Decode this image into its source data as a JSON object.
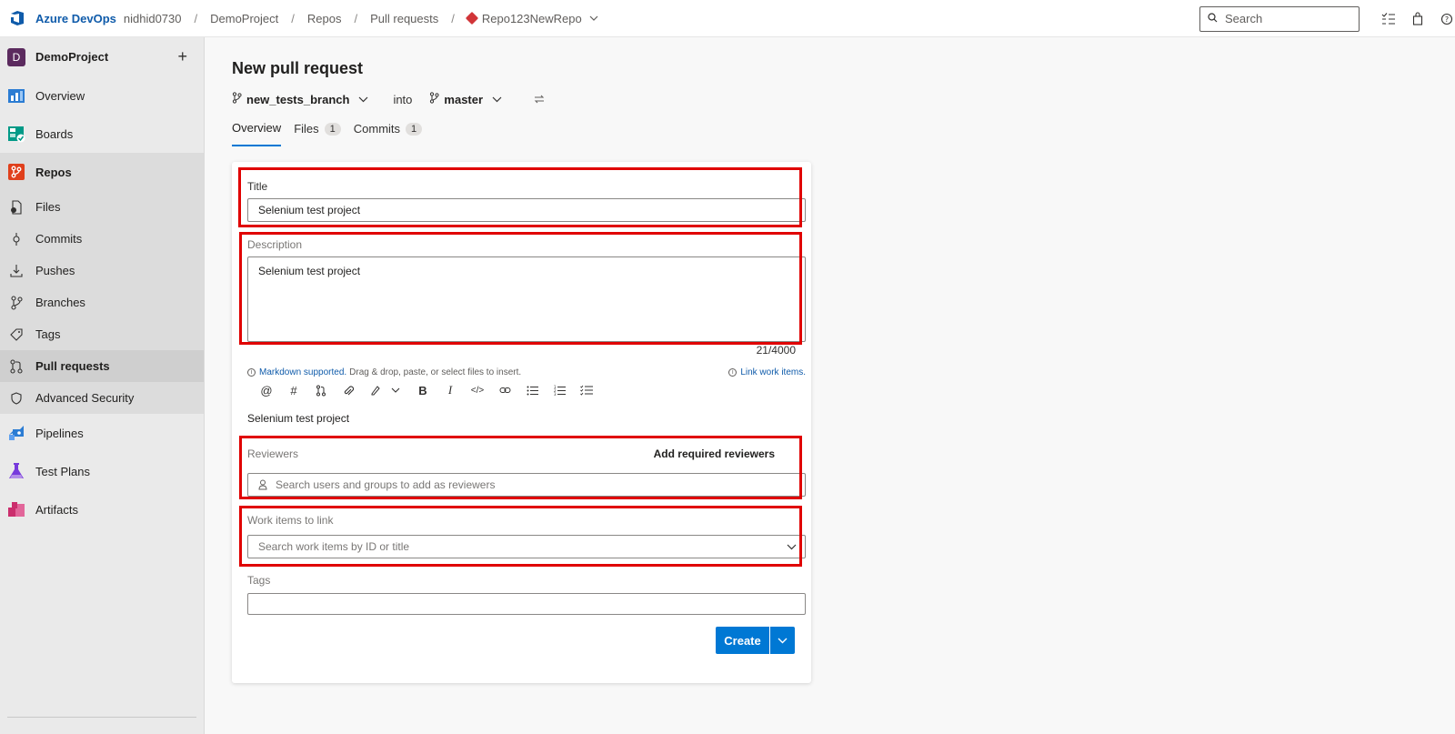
{
  "topbar": {
    "brand": "Azure DevOps",
    "breadcrumbs": [
      "nidhid0730",
      "DemoProject",
      "Repos",
      "Pull requests"
    ],
    "repo_name": "Repo123NewRepo",
    "search_placeholder": "Search"
  },
  "sidebar": {
    "project_initial": "D",
    "project_name": "DemoProject",
    "items": [
      {
        "label": "Overview"
      },
      {
        "label": "Boards"
      },
      {
        "label": "Repos"
      }
    ],
    "repo_items": [
      {
        "label": "Files"
      },
      {
        "label": "Commits"
      },
      {
        "label": "Pushes"
      },
      {
        "label": "Branches"
      },
      {
        "label": "Tags"
      },
      {
        "label": "Pull requests"
      },
      {
        "label": "Advanced Security"
      }
    ],
    "lower_items": [
      {
        "label": "Pipelines"
      },
      {
        "label": "Test Plans"
      },
      {
        "label": "Artifacts"
      }
    ]
  },
  "main": {
    "title": "New pull request",
    "source_branch": "new_tests_branch",
    "into_text": "into",
    "target_branch": "master",
    "tabs": [
      {
        "label": "Overview",
        "count": null
      },
      {
        "label": "Files",
        "count": "1"
      },
      {
        "label": "Commits",
        "count": "1"
      }
    ]
  },
  "form": {
    "title_label": "Title",
    "title_value": "Selenium test project",
    "description_label": "Description",
    "description_value": "Selenium test project",
    "char_counter": "21/4000",
    "markdown_link": "Markdown supported.",
    "markdown_hint": "Drag & drop, paste, or select files to insert.",
    "link_work_items": "Link work items.",
    "preview_text": "Selenium test project",
    "reviewers_label": "Reviewers",
    "add_required_reviewers": "Add required reviewers",
    "reviewers_placeholder": "Search users and groups to add as reviewers",
    "work_items_label": "Work items to link",
    "work_items_placeholder": "Search work items by ID or title",
    "tags_label": "Tags",
    "tags_value": "",
    "create_label": "Create"
  },
  "colors": {
    "accent": "#0078d4",
    "highlight_box": "#e00000",
    "brand": "#0f5baa"
  }
}
